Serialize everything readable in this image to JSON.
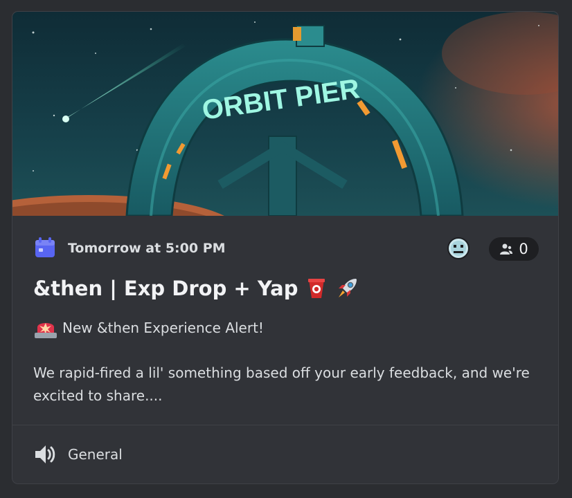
{
  "event": {
    "banner_sign_text": "ORBIT PIER",
    "start_time": "Tomorrow at 5:00 PM",
    "interested_count": "0",
    "title": "&then | Exp Drop + Yap",
    "title_emojis": [
      "cup-emoji",
      "rocket-emoji"
    ],
    "description_first_line": "New &then Experience Alert!",
    "description_body": "We rapid-fired a lil' something based off your early feedback, and we're excited to share....",
    "location_channel": "General"
  },
  "colors": {
    "background": "#2b2d31",
    "card": "#313338",
    "accent_blurple": "#5865f2",
    "text_primary": "#f2f3f5",
    "text_secondary": "#dbdee1",
    "pill_bg": "#1e1f22"
  },
  "icons": {
    "date": "calendar-icon",
    "interested": "person-icon",
    "location": "speaker-icon",
    "alert": "siren-emoji"
  }
}
